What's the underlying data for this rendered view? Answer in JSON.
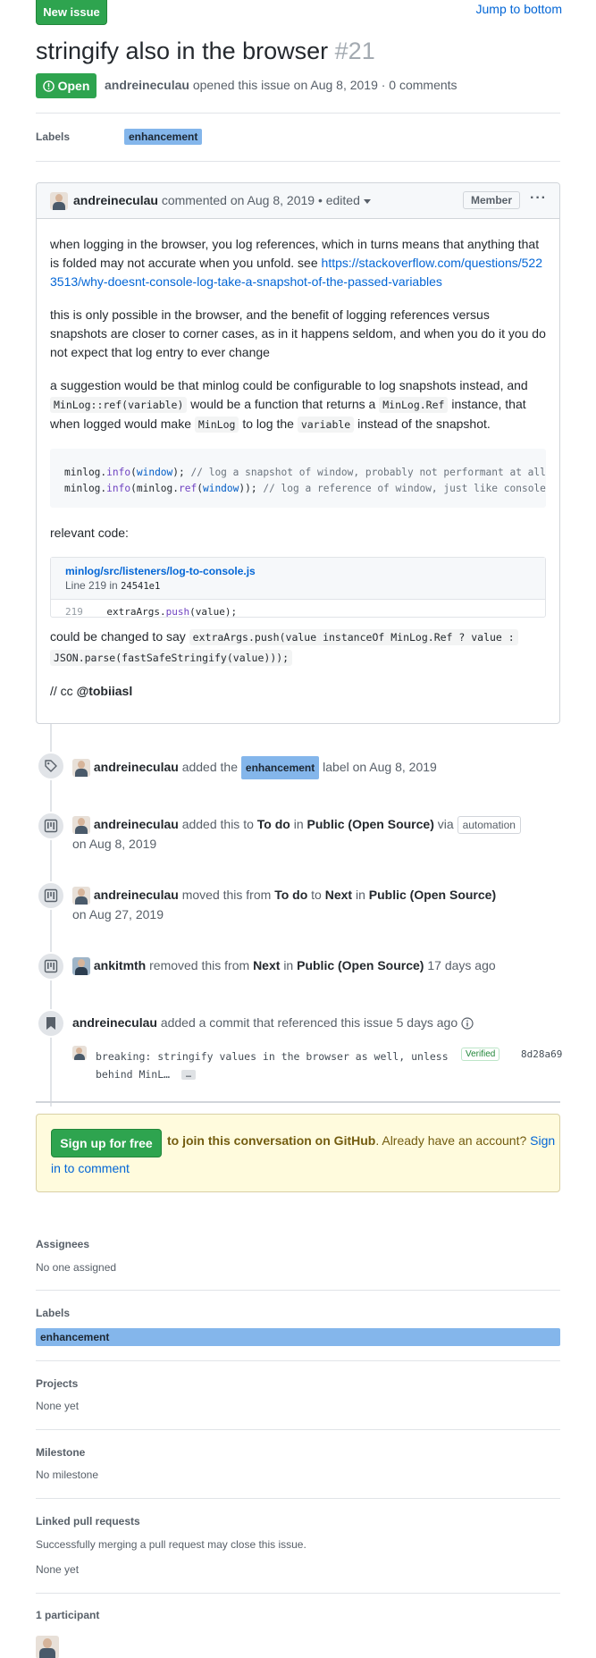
{
  "header": {
    "new_issue_label": "New issue",
    "jump_label": "Jump to bottom"
  },
  "issue": {
    "title": "stringify also in the browser",
    "number": "#21",
    "state": "Open",
    "author": "andreineculau",
    "meta": "opened this issue on Aug 8, 2019 · 0 comments"
  },
  "labels_row": {
    "heading": "Labels",
    "label": "enhancement"
  },
  "comment": {
    "author": "andreineculau",
    "meta": "commented on Aug 8, 2019",
    "edited": "• edited",
    "role": "Member",
    "p1_a": "when logging in the browser, you log references, which in turns means that anything that is folded may not accurate when you unfold. see",
    "link": "https://stackoverflow.com/questions/5223513/why-doesnt-console-log-take-a-snapshot-of-the-passed-variables",
    "p2": "this is only possible in the browser, and the benefit of logging references versus snapshots are closer to corner cases, as in it happens seldom, and when you do it you do not expect that log entry to ever change",
    "p3_a": "a suggestion would be that minlog could be configurable to log snapshots instead, and",
    "p3_code1": "MinLog::ref(variable)",
    "p3_b": "would be a function that returns a",
    "p3_code2": "MinLog.Ref",
    "p3_c": "instance, that when logged would make",
    "p3_code3": "MinLog",
    "p3_d": "to log the",
    "p3_code4": "variable",
    "p3_e": "instead of the snapshot.",
    "code_l1_a": "minlog.",
    "code_l1_fn": "info",
    "code_l1_b": "(",
    "code_l1_kw": "window",
    "code_l1_c": "); ",
    "code_l1_cm": "// log a snapshot of window, probably not performant at all",
    "code_l2_a": "minlog.",
    "code_l2_fn": "info",
    "code_l2_b": "(minlog.",
    "code_l2_fn2": "ref",
    "code_l2_c": "(",
    "code_l2_kw": "window",
    "code_l2_d": ")); ",
    "code_l2_cm": "// log a reference of window, just like console.log",
    "relevant": "relevant code:",
    "permalink_file": "minlog/src/listeners/log-to-console.js",
    "permalink_line": "Line 219 in",
    "permalink_sha": "24541e1",
    "permalink_num": "219",
    "permalink_code_a": "    extraArgs.",
    "permalink_code_fn": "push",
    "permalink_code_b": "(value);",
    "changed_a": "could be changed to say",
    "changed_code1": "extraArgs.push(value instanceOf MinLog.Ref ? value :",
    "changed_code2": "JSON.parse(fastSafeStringify(value)));",
    "cc_a": "// cc",
    "cc_user": "@tobiiasl"
  },
  "timeline": {
    "e1_user": "andreineculau",
    "e1_a": "added the",
    "e1_label": "enhancement",
    "e1_b": "label on Aug 8, 2019",
    "e2_user": "andreineculau",
    "e2_a": "added this to",
    "e2_col": "To do",
    "e2_in": "in",
    "e2_proj": "Public (Open Source)",
    "e2_via": "via",
    "e2_pill": "automation",
    "e2_date": "on Aug 8, 2019",
    "e3_user": "andreineculau",
    "e3_a": "moved this from",
    "e3_from": "To do",
    "e3_to_word": "to",
    "e3_to": "Next",
    "e3_in": "in",
    "e3_proj": "Public (Open Source)",
    "e3_date": "on Aug 27, 2019",
    "e4_user": "ankitmth",
    "e4_a": "removed this from",
    "e4_col": "Next",
    "e4_in": "in",
    "e4_proj": "Public (Open Source)",
    "e4_date": "17 days ago",
    "e5_user": "andreineculau",
    "e5_a": "added a commit that referenced this issue",
    "e5_date": "5 days ago",
    "commit_l1": "breaking: stringify values in the browser as well, unless",
    "commit_l2": "behind MinL…",
    "commit_more": "…",
    "commit_verified": "Verified",
    "commit_sha": "8d28a69"
  },
  "signup": {
    "button": "Sign up for free",
    "bold": "to join this conversation on GitHub",
    "text": ". Already have an account?",
    "link1": "Sign",
    "link2": "in to comment"
  },
  "sidebar": {
    "assignees_h": "Assignees",
    "assignees_v": "No one assigned",
    "labels_h": "Labels",
    "labels_v": "enhancement",
    "projects_h": "Projects",
    "projects_v": "None yet",
    "milestone_h": "Milestone",
    "milestone_v": "No milestone",
    "linked_h": "Linked pull requests",
    "linked_desc": "Successfully merging a pull request may close this issue.",
    "linked_v": "None yet",
    "participants_h": "1 participant"
  },
  "colors": {
    "green": "#2ea44f",
    "link": "#0366d6",
    "label": "#84b6eb"
  }
}
